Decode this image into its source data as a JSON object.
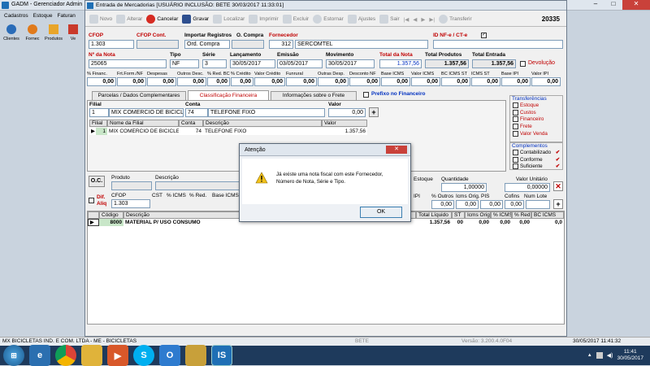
{
  "bg_app": {
    "title": "GADM - Gerenciador Admin",
    "menu": [
      "Cadastros",
      "Estoque",
      "Faturan"
    ],
    "toolbar": [
      "Clientes",
      "Fornec",
      "Produtos",
      "Ve"
    ],
    "status_left": "MX BICICLETAS IND. E COM. LTDA - ME - BICICLETAS",
    "status_mid": "BETE",
    "status_right_partial": "Versão: 3.200.4.0F04",
    "status_datetime": "30/05/2017 11:41:32"
  },
  "win": {
    "title": "Entrada de Mercadorias  [USUÁRIO INCLUSÃO: BETE 30/03/2017 11:33:01]",
    "counter": "20335"
  },
  "toolbar": {
    "novo": "Novo",
    "alterar": "Alterar",
    "cancelar": "Cancelar",
    "gravar": "Gravar",
    "localizar": "Localizar",
    "imprimir": "Imprimir",
    "excluir": "Excluir",
    "estornar": "Estornar",
    "ajustes": "Ajustes",
    "sair": "Sair",
    "transferir": "Transferir"
  },
  "header": {
    "cfop_label": "CFOP",
    "cfop": "1.303",
    "cfop_cont_label": "CFOP Cont.",
    "import_label": "Importar Registros",
    "oc_label": "O. Compra",
    "oc_value": "Ord. Compra",
    "forn_label": "Fornecedor",
    "forn_code": "312",
    "forn_name": "SERCOMTEL",
    "id_label": "ID NF-e / CT-e"
  },
  "nota": {
    "nro_label": "Nº da Nota",
    "nro": "25065",
    "tipo_label": "Tipo",
    "tipo": "NF",
    "serie_label": "Série",
    "serie": "3",
    "lanc_label": "Lançamento",
    "lanc": "30/05/2017",
    "emis_label": "Emissão",
    "emis": "03/05/2017",
    "mov_label": "Movimento",
    "mov": "30/05/2017",
    "total_nota_label": "Total da Nota",
    "total_nota": "1.357,56",
    "total_prod_label": "Total Produtos",
    "total_prod": "1.357,56",
    "total_ent_label": "Total Entrada",
    "total_ent": "1.357,56",
    "devol": "Devolução"
  },
  "taxes": [
    {
      "l": "% Financ.",
      "v": "0,00"
    },
    {
      "l": "Frt.Form./NF",
      "v": "0,00"
    },
    {
      "l": "Despesas",
      "v": "0,00"
    },
    {
      "l": "Outros Desc.",
      "v": "0,00"
    },
    {
      "l": "% Red. BC",
      "v": "0,00"
    },
    {
      "l": "% Crédito",
      "v": "0,00"
    },
    {
      "l": "Valor Crédito",
      "v": "0,00"
    },
    {
      "l": "Funrural",
      "v": "0,00"
    },
    {
      "l": "Outras Desp.",
      "v": "0,00"
    },
    {
      "l": "Desconto NF",
      "v": "0,00"
    },
    {
      "l": "Base ICMS",
      "v": "0,00"
    },
    {
      "l": "Valor ICMS",
      "v": "0,00"
    },
    {
      "l": "BC ICMS ST",
      "v": "0,00"
    },
    {
      "l": "ICMS ST",
      "v": "0,00"
    },
    {
      "l": "Base IPI",
      "v": "0,00"
    },
    {
      "l": "Valor IPI",
      "v": "0,00"
    }
  ],
  "tabs": [
    "Parcelas / Dados Complementares",
    "Classificação Financeira",
    "Informações sobre o Frete"
  ],
  "prefixo": "Prefixo no Financeiro",
  "fin": {
    "filial_label": "Filial",
    "filial": "1",
    "filial_name": "MIX COMERCIO DE BICICLET",
    "conta_label": "Conta",
    "conta": "74",
    "conta_name": "TELEFONE FIXO",
    "valor_label": "Valor",
    "valor": "0,00",
    "cols": [
      "Filial",
      "Nome da Filial",
      "Conta",
      "Descrição",
      "Valor"
    ],
    "row": [
      "1",
      "MIX COMERCIO DE BICICLET",
      "74",
      "TELEFONE FIXO",
      "1.357,56"
    ]
  },
  "transf": {
    "title": "Transferências",
    "items": [
      "Estoque",
      "Custos",
      "Financeiro",
      "Frete",
      "Valor Venda"
    ]
  },
  "compl": {
    "title": "Complementos",
    "items": [
      "Contabilizado",
      "Conforme",
      "Suficiente"
    ]
  },
  "items": {
    "oc": "O.C.",
    "produto": "Produto",
    "descricao": "Descrição",
    "estoque": "Estoque",
    "quantidade": "Quantidade",
    "quantidade_v": "1,00000",
    "valor_unit": "Valor Unitário",
    "valor_unit_v": "0,00000",
    "dif": "Dif.",
    "aliq": "Aliq",
    "cfop_label": "CFOP",
    "cfop": "1.303",
    "cst": "CST",
    "icms": "% ICMS",
    "red": "% Red.",
    "base": "Base ICMS",
    "ipi": "IPI",
    "outros": "% Outros",
    "icms_orig": "Icms Orig.",
    "pis": "PIS",
    "cofins": "Cofins",
    "numlote": "Num Lote",
    "outros_v": "0,00",
    "icms_orig_v": "0,00",
    "pis_v": "0,00",
    "cofins_v": "0,00",
    "cols": [
      "Código",
      "Descrição",
      "Total Líquido",
      "ST",
      "Icms Orig.",
      "% ICMS",
      "% Red",
      "BC ICMS"
    ],
    "row": [
      "8000",
      "MATERIAL P/ USO CONSUMO",
      "1.357,56",
      "00",
      "0,00",
      "0,00",
      "0,00",
      "0,0"
    ]
  },
  "dialog": {
    "title": "Atenção",
    "message": "Já existe uma nota fiscal com este Fornecedor, Número de Nota, Série e Tipo.",
    "ok": "OK",
    "close": "✕"
  },
  "taskbar": {
    "time": "11:41",
    "date": "30/05/2017"
  }
}
